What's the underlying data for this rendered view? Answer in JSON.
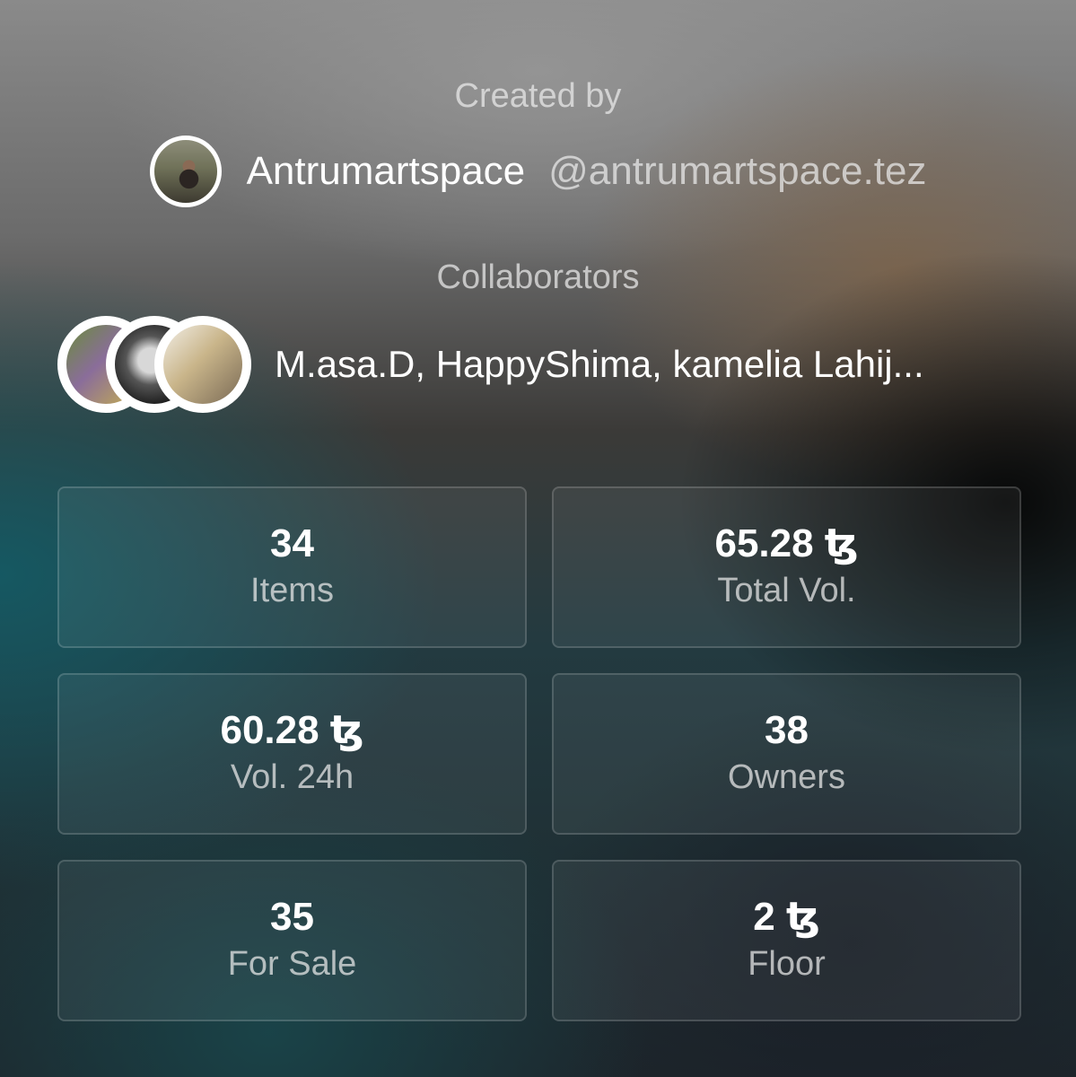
{
  "creator": {
    "section_label": "Created by",
    "name": "Antrumartspace",
    "handle": "@antrumartspace.tez",
    "avatar_icon": "user-avatar"
  },
  "collaborators": {
    "section_label": "Collaborators",
    "names": "M.asa.D, HappyShima, kamelia Lahij...",
    "avatar_icons": [
      "collaborator-avatar",
      "collaborator-avatar",
      "collaborator-avatar"
    ]
  },
  "stats": [
    {
      "value": "34",
      "label": "Items"
    },
    {
      "value": "65.28 ꜩ",
      "label": "Total Vol."
    },
    {
      "value": "60.28 ꜩ",
      "label": "Vol. 24h"
    },
    {
      "value": "38",
      "label": "Owners"
    },
    {
      "value": "35",
      "label": "For Sale"
    },
    {
      "value": "2 ꜩ",
      "label": "Floor"
    }
  ]
}
